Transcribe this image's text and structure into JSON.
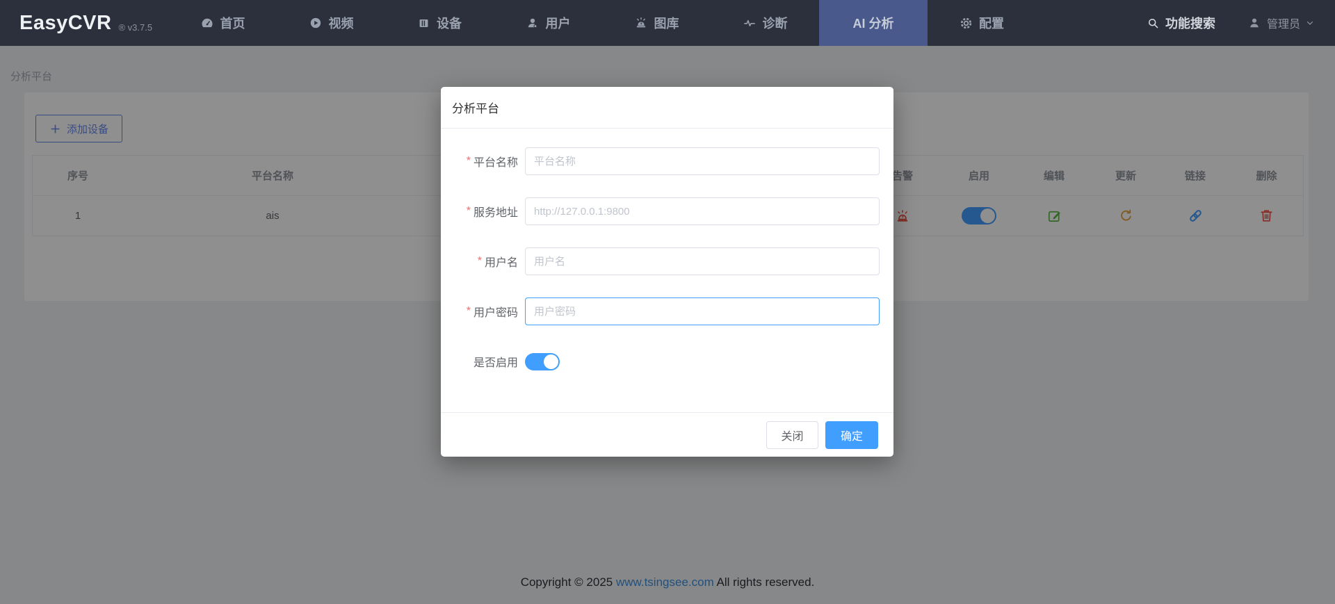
{
  "navbar": {
    "logo": "EasyCVR",
    "version": "® v3.7.5",
    "items": [
      {
        "label": "首页",
        "icon": "dashboard-icon",
        "active": false
      },
      {
        "label": "视频",
        "icon": "video-icon",
        "active": false
      },
      {
        "label": "设备",
        "icon": "device-icon",
        "active": false
      },
      {
        "label": "用户",
        "icon": "user-icon",
        "active": false
      },
      {
        "label": "图库",
        "icon": "gallery-icon",
        "active": false
      },
      {
        "label": "诊断",
        "icon": "diagnosis-icon",
        "active": false
      },
      {
        "label": "AI 分析",
        "icon": null,
        "active": true
      },
      {
        "label": "配置",
        "icon": "gear-icon",
        "active": false
      }
    ],
    "search_label": "功能搜索",
    "user_label": "管理员"
  },
  "breadcrumb": "分析平台",
  "content": {
    "add_button": "添加设备",
    "table": {
      "columns": [
        "序号",
        "平台名称",
        "",
        "告警",
        "启用",
        "编辑",
        "更新",
        "链接",
        "删除"
      ],
      "rows": [
        {
          "index": "1",
          "platform_name": "ais",
          "enabled": true,
          "action_icons": [
            "siren-icon",
            "toggle-on",
            "edit-icon",
            "refresh-icon",
            "link-icon",
            "trash-icon"
          ]
        }
      ]
    }
  },
  "modal": {
    "title": "分析平台",
    "required_mark": "*",
    "fields": [
      {
        "label": "平台名称",
        "required": true,
        "type": "text",
        "value": "",
        "placeholder": "平台名称",
        "focused": false
      },
      {
        "label": "服务地址",
        "required": true,
        "type": "text",
        "value": "",
        "placeholder": "http://127.0.0.1:9800",
        "focused": false
      },
      {
        "label": "用户名",
        "required": true,
        "type": "text",
        "value": "",
        "placeholder": "用户名",
        "focused": false
      },
      {
        "label": "用户密码",
        "required": true,
        "type": "text",
        "value": "",
        "placeholder": "用户密码",
        "focused": true
      },
      {
        "label": "是否启用",
        "required": false,
        "type": "switch",
        "value": true
      }
    ],
    "close_label": "关闭",
    "confirm_label": "确定"
  },
  "footer": {
    "text_before": "Copyright © 2025 ",
    "link": "www.tsingsee.com",
    "text_after": " All rights reserved."
  },
  "colors": {
    "navbar_bg": "#2b303c",
    "active_tab": "#49598c",
    "accent_blue": "#409eff",
    "add_button_blue": "#6688e8",
    "success_green": "#5cb843",
    "warning_orange": "#e6a23c",
    "danger_red": "#f15549",
    "siren_red": "#e8543f",
    "link_blue": "#3f8fdd",
    "required_red": "#f56c6c"
  }
}
